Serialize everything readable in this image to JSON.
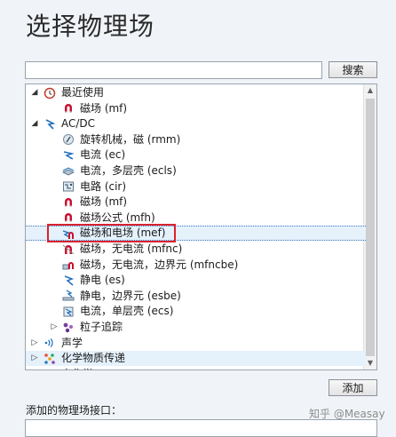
{
  "page": {
    "title": "选择物理场"
  },
  "search": {
    "placeholder": "",
    "value": "",
    "button_label": "搜索"
  },
  "tree": {
    "rows": [
      {
        "label": "最近使用",
        "toggle": "◢",
        "icon": "clock-icon",
        "level": 0
      },
      {
        "label": "磁场 (mf)",
        "toggle": "",
        "icon": "magnet-icon",
        "level": 1
      },
      {
        "label": "AC/DC",
        "toggle": "◢",
        "icon": "acdc-icon",
        "level": 0
      },
      {
        "label": "旋转机械，磁 (rmm)",
        "toggle": "",
        "icon": "rotating-machinery-icon",
        "level": 1
      },
      {
        "label": "电流 (ec)",
        "toggle": "",
        "icon": "electric-current-icon",
        "level": 1
      },
      {
        "label": "电流，多层壳 (ecls)",
        "toggle": "",
        "icon": "layered-shell-icon",
        "level": 1
      },
      {
        "label": "电路 (cir)",
        "toggle": "",
        "icon": "circuit-icon",
        "level": 1
      },
      {
        "label": "磁场 (mf)",
        "toggle": "",
        "icon": "magnet-icon",
        "level": 1
      },
      {
        "label": "磁场公式 (mfh)",
        "toggle": "",
        "icon": "magnet-icon",
        "level": 1
      },
      {
        "label": "磁场和电场 (mef)",
        "toggle": "",
        "icon": "magnetic-electric-icon",
        "level": 1
      },
      {
        "label": "磁场，无电流 (mfnc)",
        "toggle": "",
        "icon": "magnet-no-current-icon",
        "level": 1
      },
      {
        "label": "磁场，无电流，边界元 (mfncbe)",
        "toggle": "",
        "icon": "boundary-element-icon",
        "level": 1
      },
      {
        "label": "静电 (es)",
        "toggle": "",
        "icon": "electrostatics-icon",
        "level": 1
      },
      {
        "label": "静电，边界元 (esbe)",
        "toggle": "",
        "icon": "electrostatics-boundary-icon",
        "level": 1
      },
      {
        "label": "电流，单层壳 (ecs)",
        "toggle": "",
        "icon": "single-shell-icon",
        "level": 1
      },
      {
        "label": "粒子追踪",
        "toggle": "▷",
        "icon": "particle-icon",
        "level": 1
      },
      {
        "label": "声学",
        "toggle": "▷",
        "icon": "acoustics-icon",
        "level": 0
      },
      {
        "label": "化学物质传递",
        "toggle": "▷",
        "icon": "chemical-transport-icon",
        "level": 0
      },
      {
        "label": "电化学",
        "toggle": "▷",
        "icon": "electrochemistry-icon",
        "level": 0
      }
    ],
    "selected_index": 9,
    "hover_index": 17
  },
  "add": {
    "button_label": "添加"
  },
  "added": {
    "label": "添加的物理场接口："
  },
  "watermark": {
    "text": "知乎 @Measay"
  },
  "colors": {
    "accent": "#3a78c3",
    "highlight": "#d9232e",
    "selection_bg": "#e5f1fb",
    "magnet_red": "#c8102e",
    "electric_blue": "#1f6fbf"
  }
}
